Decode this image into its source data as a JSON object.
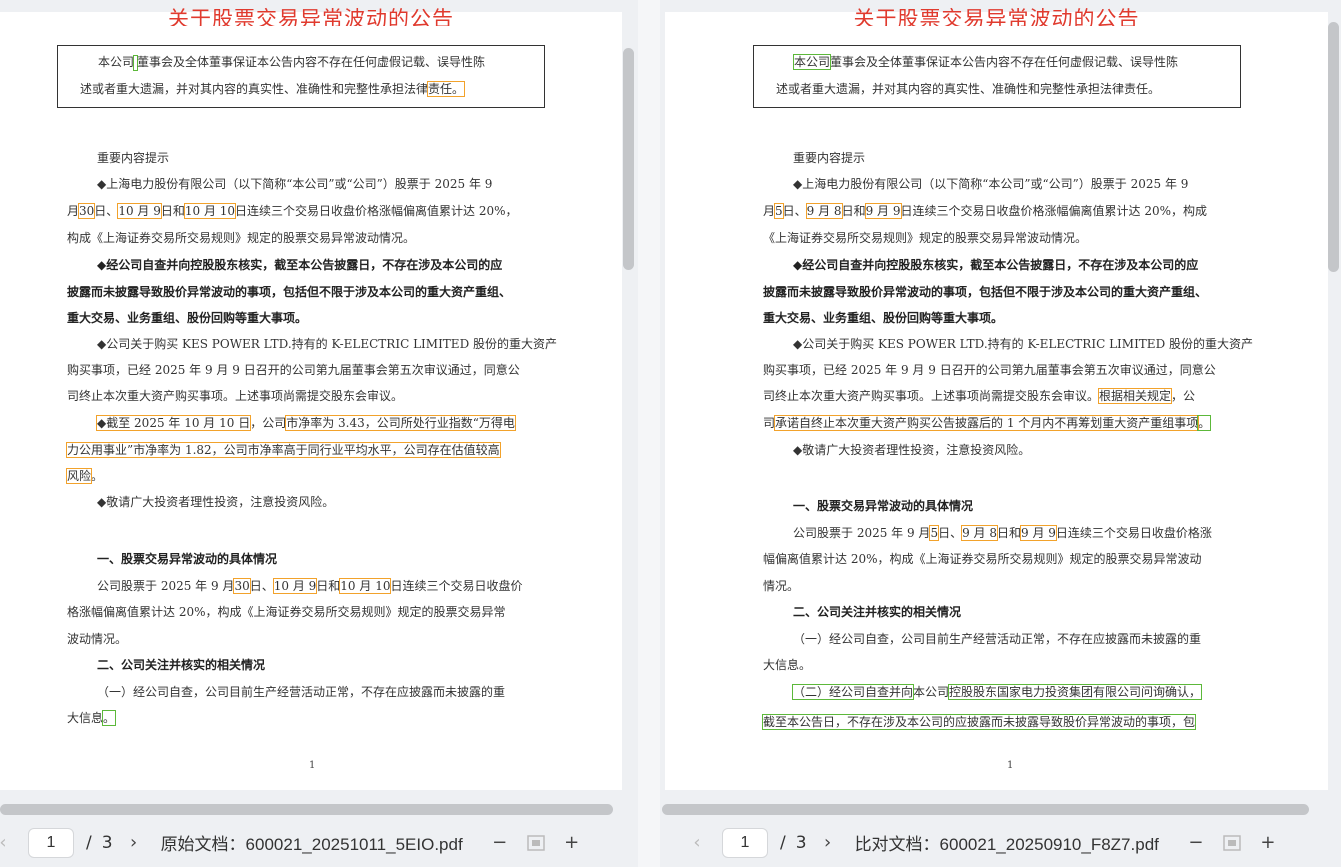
{
  "title": "关于股票交易异常波动的公告",
  "disclaimer": {
    "line1_a": "本公司",
    "line1_b": "董事会及全体董事保证本公告内容不存在任何虚假记载、误导性陈",
    "line2_a": "述或者重大遗漏，并对其内容的真实性、准确性和完整性承担法律",
    "line2_b": "责任。",
    "line2_right": "述或者重大遗漏，并对其内容的真实性、准确性和完整性承担法律责任。"
  },
  "left": {
    "lines": {
      "heading_tip": "重要内容提示",
      "p1a": "◆上海电力股份有限公司（以下简称“本公司”或“公司”）股票于 2025 年 9",
      "p1b_1": "月",
      "p1b_d1": "30",
      "p1b_2": "日、",
      "p1b_d2": "10 月 9",
      "p1b_3": "日和",
      "p1b_d3": "10 月 10",
      "p1b_4": "日连续三个交易日收盘价格涨幅偏离值累计达 20%，",
      "p1c": "构成《上海证券交易所交易规则》规定的股票交易异常波动情况。",
      "p2a": "◆经公司自查并向控股股东核实，截至本公告披露日，不存在涉及本公司的应",
      "p2b": "披露而未披露导致股价异常波动的事项，包括但不限于涉及本公司的重大资产重组、",
      "p2c": "重大交易、业务重组、股份回购等重大事项。",
      "p3a": "◆公司关于购买 KES POWER LTD.持有的 K-ELECTRIC LIMITED 股份的重大资产",
      "p3b": "购买事项，已经 2025 年 9 月 9 日召开的公司第九届董事会第五次审议通过，同意公",
      "p3c": "司终止本次重大资产购买事项。上述事项尚需提交股东会审议。",
      "p4a_1": "◆截至 2025 年 10 月 10 日",
      "p4a_2": "，公司",
      "p4a_3": "市净率为 3.43，公司所处行业指数“万得电",
      "p4b": "力公用事业”市净率为 1.82，公司市净率高于同行业平均水平，公司存在估值较高",
      "p4c_1": "风险",
      "p4c_2": "。",
      "p5": "◆敬请广大投资者理性投资，注意投资风险。",
      "h1": "一、股票交易异常波动的具体情况",
      "s1a_1": "公司股票于 2025 年 9 月",
      "s1a_d1": "30",
      "s1a_2": "日、",
      "s1a_d2": "10 月 9",
      "s1a_3": "日和",
      "s1a_d3": "10 月 10",
      "s1a_4": "日连续三个交易日收盘价",
      "s1b": "格涨幅偏离值累计达 20%，构成《上海证券交易所交易规则》规定的股票交易异常",
      "s1c": "波动情况。",
      "h2": "二、公司关注并核实的相关情况",
      "s2a": "（一）经公司自查，公司目前生产经营活动正常，不存在应披露而未披露的重",
      "s2b_1": "大信息",
      "s2b_2": "。"
    },
    "page_number": "1"
  },
  "right": {
    "lines": {
      "heading_tip": "重要内容提示",
      "p1a": "◆上海电力股份有限公司（以下简称“本公司”或“公司”）股票于 2025 年 9",
      "p1b_1": "月",
      "p1b_d1": "5",
      "p1b_2": "日、",
      "p1b_d2": "9 月 8",
      "p1b_3": "日和",
      "p1b_d3": "9 月 9",
      "p1b_4": "日连续三个交易日收盘价格涨幅偏离值累计达 20%，构成",
      "p1c": "《上海证券交易所交易规则》规定的股票交易异常波动情况。",
      "p2a": "◆经公司自查并向控股股东核实，截至本公告披露日，不存在涉及本公司的应",
      "p2b": "披露而未披露导致股价异常波动的事项，包括但不限于涉及本公司的重大资产重组、",
      "p2c": "重大交易、业务重组、股份回购等重大事项。",
      "p3a": "◆公司关于购买 KES POWER LTD.持有的 K-ELECTRIC LIMITED 股份的重大资产",
      "p3b": "购买事项，已经 2025 年 9 月 9 日召开的公司第九届董事会第五次审议通过，同意公",
      "p3c_1": "司终止本次重大资产购买事项。上述事项尚需提交股东会审议。",
      "p3c_2": "根据相关规定",
      "p3c_3": "，公",
      "p3d_1": "司",
      "p3d_2": "承诺自终止本次重大资产购买公告披露后的 1 个月内不再筹划重大资产重组事项",
      "p3d_3": "。",
      "p5": "◆敬请广大投资者理性投资，注意投资风险。",
      "h1": "一、股票交易异常波动的具体情况",
      "s1a_1": "公司股票于 2025 年 9 月",
      "s1a_d1": "5",
      "s1a_2": "日、",
      "s1a_d2": "9 月 8",
      "s1a_3": "日和",
      "s1a_d3": "9 月 9",
      "s1a_4": "日连续三个交易日收盘价格涨",
      "s1b": "幅偏离值累计达 20%，构成《上海证券交易所交易规则》规定的股票交易异常波动",
      "s1c": "情况。",
      "h2": "二、公司关注并核实的相关情况",
      "s2a": "（一）经公司自查，公司目前生产经营活动正常，不存在应披露而未披露的重",
      "s2b": "大信息。",
      "s3a_1": "（二）经公司自查并向",
      "s3a_2": "本公司",
      "s3a_3": "控股股东国家电力投资集团有限公司问询确认，",
      "s3b": "截至本公告日，不存在涉及本公司的应披露而未披露导致股价异常波动的事项，包"
    },
    "page_number": "1"
  },
  "toolbars": {
    "left": {
      "current_page": "1",
      "separator": "/",
      "total_pages": "3",
      "file_label": "原始文档：600021_20251011_5EIO.pdf"
    },
    "right": {
      "current_page": "1",
      "separator": "/",
      "total_pages": "3",
      "file_label": "比对文档：600021_20250910_F8Z7.pdf"
    }
  },
  "colors": {
    "title_red": "#e03a2e",
    "diff_orange": "#f2a22b",
    "diff_green": "#5cb83a"
  },
  "icons": [
    "prev-page-icon",
    "next-page-icon",
    "zoom-out-icon",
    "fit-page-icon",
    "zoom-in-icon"
  ]
}
